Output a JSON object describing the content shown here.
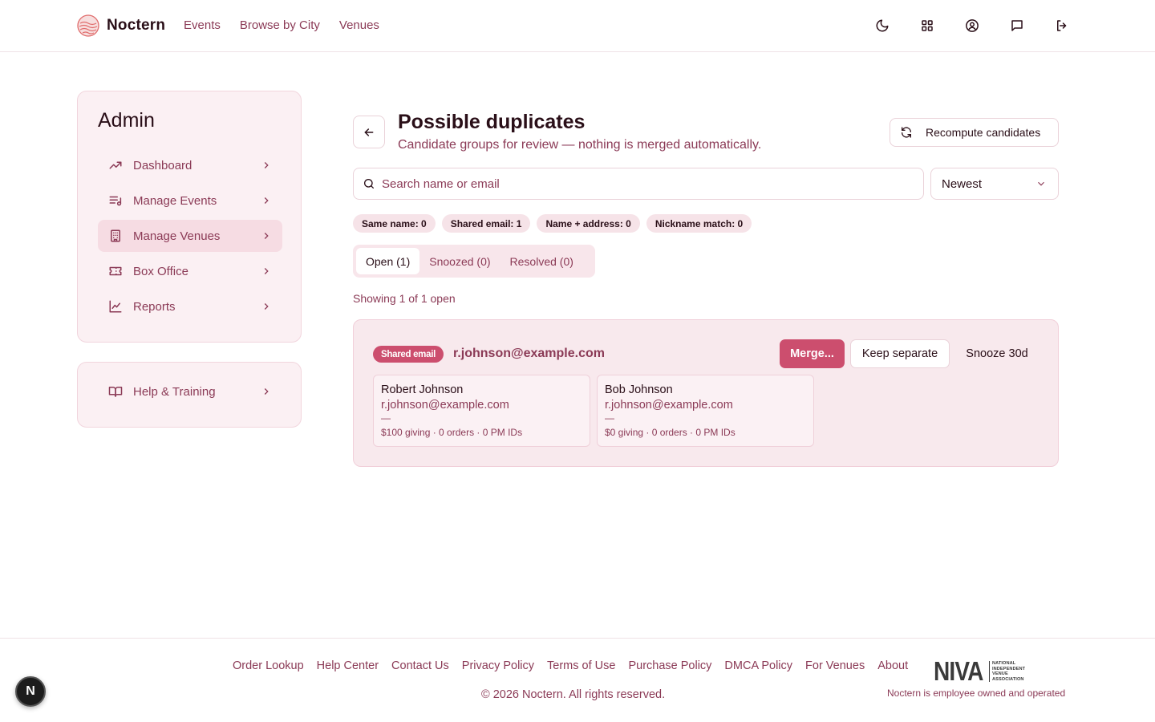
{
  "header": {
    "brand": "Noctern",
    "nav": [
      "Events",
      "Browse by City",
      "Venues"
    ],
    "icons": [
      "moon-icon",
      "grid-icon",
      "user-circle-icon",
      "message-icon",
      "logout-icon"
    ]
  },
  "sidebar": {
    "title": "Admin",
    "items": [
      {
        "label": "Dashboard",
        "icon": "trending-up-icon"
      },
      {
        "label": "Manage Events",
        "icon": "list-music-icon"
      },
      {
        "label": "Manage Venues",
        "icon": "building-icon",
        "active": true
      },
      {
        "label": "Box Office",
        "icon": "ticket-icon"
      },
      {
        "label": "Reports",
        "icon": "line-chart-icon"
      }
    ],
    "help": {
      "label": "Help & Training",
      "icon": "book-open-icon"
    }
  },
  "main": {
    "title": "Possible duplicates",
    "subtitle": "Candidate groups for review — nothing is merged automatically.",
    "recompute_label": "Recompute candidates",
    "search": {
      "placeholder": "Search name or email",
      "value": ""
    },
    "sort": {
      "selected": "Newest"
    },
    "chips": [
      "Same name: 0",
      "Shared email: 1",
      "Name + address: 0",
      "Nickname match: 0"
    ],
    "tabs": [
      {
        "label": "Open (1)",
        "active": true
      },
      {
        "label": "Snoozed (0)",
        "active": false
      },
      {
        "label": "Resolved (0)",
        "active": false
      }
    ],
    "showing": "Showing 1 of 1 open",
    "group": {
      "badge": "Shared email",
      "email": "r.johnson@example.com",
      "merge_label": "Merge...",
      "keep_label": "Keep separate",
      "snooze_label": "Snooze 30d",
      "people": [
        {
          "name": "Robert Johnson",
          "email": "r.johnson@example.com",
          "dash": "—",
          "stats": "$100 giving · 0 orders · 0 PM IDs"
        },
        {
          "name": "Bob Johnson",
          "email": "r.johnson@example.com",
          "dash": "—",
          "stats": "$0 giving · 0 orders · 0 PM IDs"
        }
      ]
    }
  },
  "footer": {
    "links": [
      "Order Lookup",
      "Help Center",
      "Contact Us",
      "Privacy Policy",
      "Terms of Use",
      "Purchase Policy",
      "DMCA Policy",
      "For Venues",
      "About"
    ],
    "copyright": "© 2026 Noctern. All rights reserved.",
    "niva": {
      "word": "NIVA",
      "lines": [
        "NATIONAL",
        "INDEPENDENT",
        "VENUE",
        "ASSOCIATION"
      ]
    },
    "employee_note": "Noctern is employee owned and operated"
  },
  "dev_badge": "N",
  "colors": {
    "accent": "#cc4e6e",
    "muted_text": "#8b3a56",
    "card_bg": "#fbf0f3"
  }
}
